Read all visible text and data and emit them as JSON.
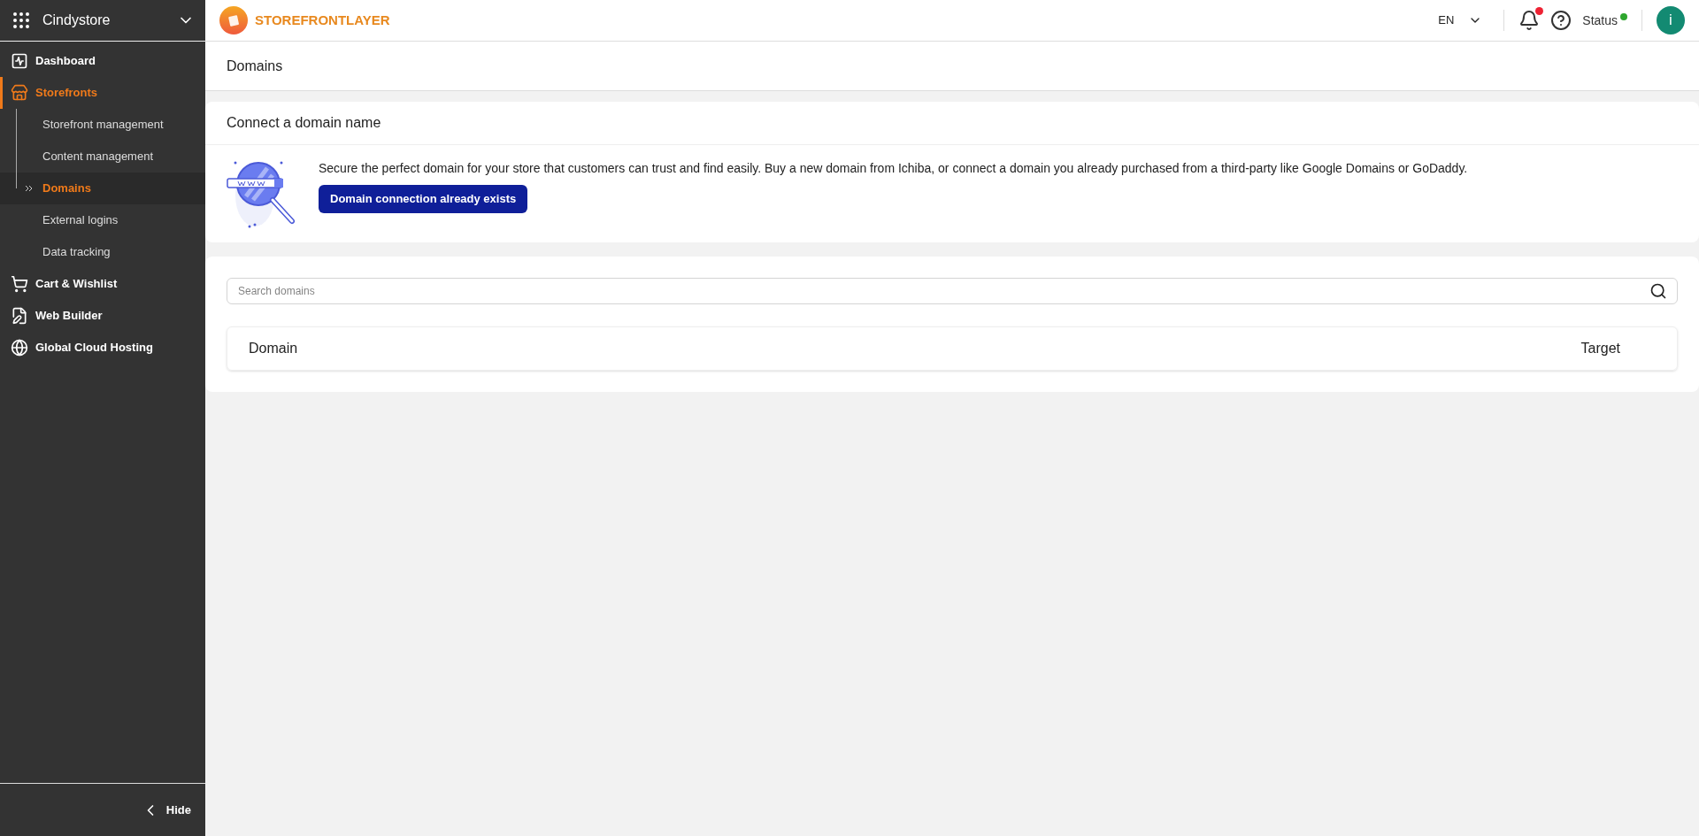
{
  "store_switcher": {
    "name": "Cindystore"
  },
  "sidebar": {
    "items": [
      {
        "label": "Dashboard",
        "kind": "dashboard",
        "selected": false
      },
      {
        "label": "Storefronts",
        "kind": "store",
        "selected": true,
        "expanded": true,
        "children": [
          {
            "label": "Storefront management",
            "selected": false
          },
          {
            "label": "Content management",
            "selected": false
          },
          {
            "label": "Domains",
            "selected": true
          },
          {
            "label": "External logins",
            "selected": false
          },
          {
            "label": "Data tracking",
            "selected": false
          }
        ]
      },
      {
        "label": "Cart & Wishlist",
        "kind": "cart",
        "selected": false
      },
      {
        "label": "Web Builder",
        "kind": "builder",
        "selected": false
      },
      {
        "label": "Global Cloud Hosting",
        "kind": "globe",
        "selected": false
      }
    ],
    "hide_label": "Hide"
  },
  "topbar": {
    "brand": "STOREFRONTLAYER",
    "language": "EN",
    "notifications_unread": true,
    "status_label": "Status",
    "status_online": true,
    "avatar_letter": "i"
  },
  "page_title": "Domains",
  "connect_card": {
    "title": "Connect a domain name",
    "description": "Secure the perfect domain for your store that customers can trust and find easily. Buy a new domain from Ichiba, or connect a domain you already purchased from a third-party like Google Domains or GoDaddy.",
    "button": "Domain connection already exists"
  },
  "domains_table": {
    "search_placeholder": "Search domains",
    "columns": [
      "Domain",
      "Target"
    ]
  }
}
